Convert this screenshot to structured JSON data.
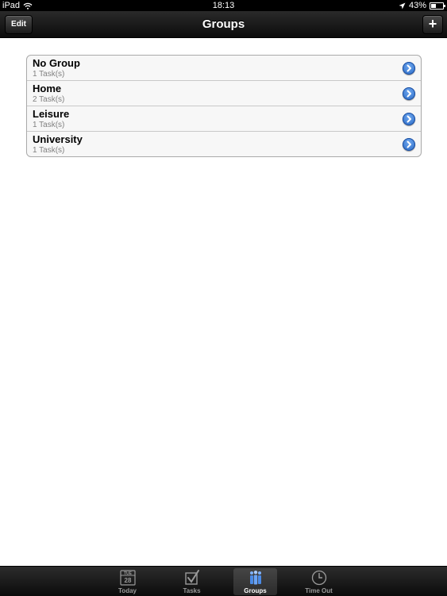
{
  "status": {
    "device": "iPad",
    "time": "18:13",
    "battery": "43%",
    "battery_level": 0.43
  },
  "navbar": {
    "title": "Groups",
    "edit_label": "Edit",
    "add_label": "+"
  },
  "groups": [
    {
      "name": "No Group",
      "count": "1 Task(s)"
    },
    {
      "name": "Home",
      "count": "2 Task(s)"
    },
    {
      "name": "Leisure",
      "count": "1 Task(s)"
    },
    {
      "name": "University",
      "count": "1 Task(s)"
    }
  ],
  "tabs": [
    {
      "label": "Today",
      "icon": "calendar-icon",
      "day": "TUE",
      "date": "28"
    },
    {
      "label": "Tasks",
      "icon": "checkbox-icon"
    },
    {
      "label": "Groups",
      "icon": "people-icon",
      "active": true
    },
    {
      "label": "Time Out",
      "icon": "clock-icon"
    }
  ],
  "colors": {
    "accent": "#2566c4",
    "navbar": "#1a1a1a"
  }
}
